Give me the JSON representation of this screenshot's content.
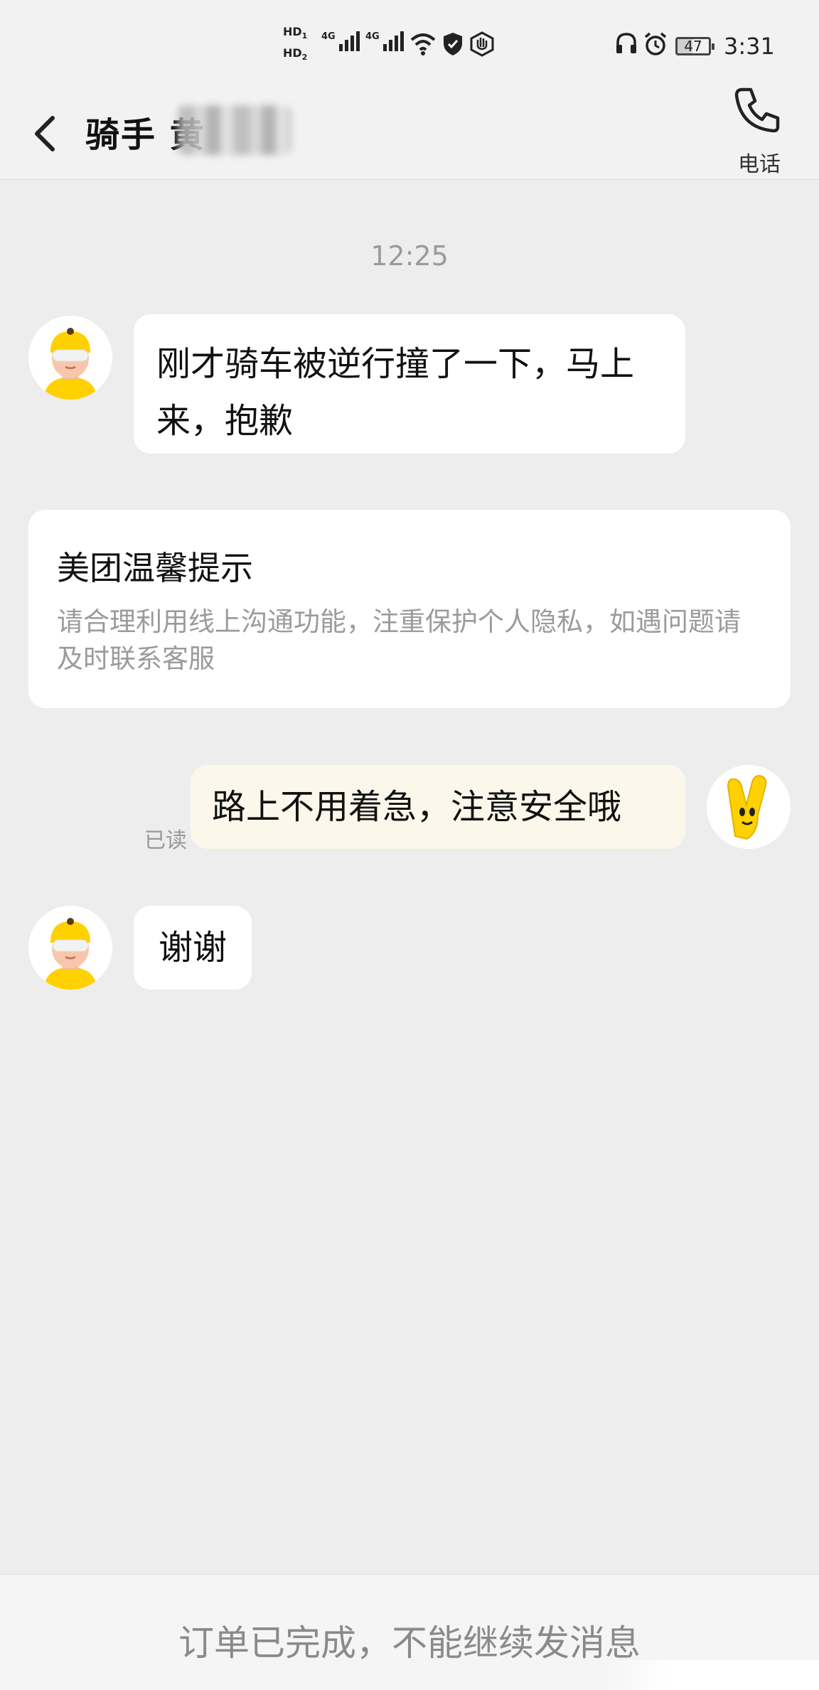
{
  "status_bar": {
    "hd1": "HD",
    "hd1_sub": "1",
    "hd2": "HD",
    "hd2_sub": "2",
    "network1": "4G",
    "network2": "4G",
    "battery": "47",
    "time": "3:31",
    "icons": [
      "hd-icon",
      "signal-icon",
      "wifi-icon",
      "shield-icon",
      "hand-icon",
      "headset-icon",
      "alarm-icon",
      "battery-icon"
    ]
  },
  "header": {
    "title": "骑手 黄",
    "back_icon": "chevron-left-icon",
    "phone_icon": "phone-icon",
    "phone_label": "电话"
  },
  "chat": {
    "timestamp": "12:25",
    "messages": [
      {
        "from": "rider",
        "text": "刚才骑车被逆行撞了一下，马上来，抱歉"
      },
      {
        "from": "user",
        "text": "路上不用着急，注意安全哦",
        "status": "已读"
      },
      {
        "from": "rider",
        "text": "谢谢"
      }
    ],
    "notice": {
      "title": "美团温馨提示",
      "body": "请合理利用线上沟通功能，注重保护个人隐私，如遇问题请及时联系客服"
    }
  },
  "footer": {
    "text": "订单已完成，不能继续发消息"
  },
  "colors": {
    "background": "#ededed",
    "bubble": "#ffffff",
    "user_bubble": "#fbf7ea",
    "brand_yellow": "#ffd100"
  }
}
